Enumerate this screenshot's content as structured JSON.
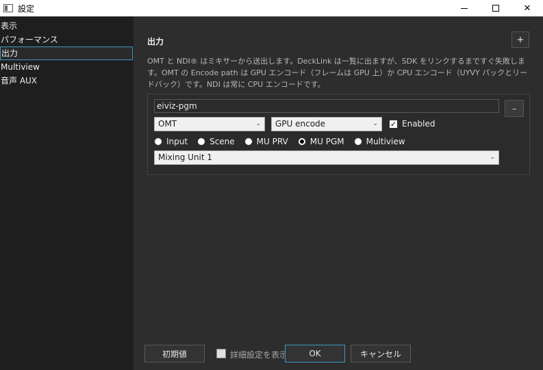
{
  "window": {
    "title": "設定",
    "minimize_icon": "minimize-icon",
    "maximize_icon": "maximize-icon",
    "close_glyph": "✕"
  },
  "sidebar": {
    "items": [
      {
        "label": "表示",
        "selected": false
      },
      {
        "label": "パフォーマンス",
        "selected": false
      },
      {
        "label": "出力",
        "selected": true
      },
      {
        "label": "Multiview",
        "selected": false
      },
      {
        "label": "音声 AUX",
        "selected": false
      }
    ]
  },
  "output": {
    "title": "出力",
    "add_label": "+",
    "description": "OMT と NDI® はミキサーから送出します。DeckLink は一覧に出ますが、SDK をリンクするまですぐ失敗します。OMT の Encode path は GPU エンコード（フレームは GPU 上）か CPU エンコード（UYVY パックとリードバック）です。NDI は常に CPU エンコードです。",
    "entry": {
      "name_value": "eiviz-pgm",
      "remove_label": "–",
      "protocol": "OMT",
      "encode": "GPU encode",
      "enabled_label": "Enabled",
      "enabled": true,
      "sources": [
        "Input",
        "Scene",
        "MU PRV",
        "MU PGM",
        "Multiview"
      ],
      "selected_source": "MU PGM",
      "mixing_unit": "Mixing Unit 1",
      "chevron": "⌄"
    }
  },
  "footer": {
    "defaults_label": "初期値",
    "advanced_label": "詳細設定を表示",
    "ok_label": "OK",
    "cancel_label": "キャンセル"
  }
}
